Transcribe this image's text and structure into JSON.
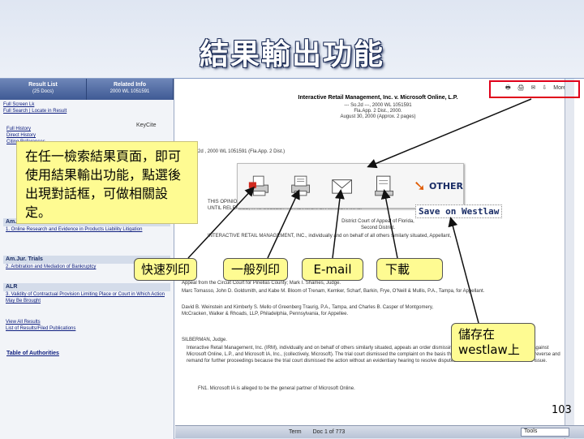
{
  "slide": {
    "title": "結果輸出功能",
    "page_number": "103",
    "note_text": "在任一檢索結果頁面，即可使用結果輸出功能，點選後出現對話框，可做相關設定。",
    "callouts": {
      "fast_print": "快速列印",
      "normal_print": "一般列印",
      "email": "E-mail",
      "download": "下載",
      "save_westlaw": "儲存在 westlaw上"
    }
  },
  "left_panel": {
    "tabs": [
      {
        "label": "Result List",
        "sub": "(25 Docs)"
      },
      {
        "label": "Related Info",
        "sub": "2000 WL 1051591"
      }
    ],
    "links": [
      "Full Screen Lk",
      "Full Search | Locate in Result"
    ],
    "keycite": "KeyCite",
    "keycite_links": [
      "Full History",
      "Direct History",
      "Citing References"
    ],
    "sections": [
      {
        "header": "Am.Jur. Proof of Facts",
        "items": [
          "1. Online Research and Evidence in Products Liability Litigation"
        ]
      },
      {
        "header": "Am.Jur. Trials",
        "items": [
          "2. Arbitration and Mediation of Bankruptcy"
        ]
      },
      {
        "header": "ALR",
        "items": [
          "3. Validity of Contractual Provision Limiting Place or Court in Which Action May Be Brought"
        ]
      }
    ],
    "more_links": [
      "View All Results",
      "List of Results/Filed Publications"
    ],
    "toa": "Table of Authorities"
  },
  "document": {
    "title": "Interactive Retail Management, Inc. v. Microsoft Online, L.P.",
    "meta": [
      "--- So.2d ---, 2000 WL 1051591",
      "Fla.App. 2 Dist., 2000.",
      "August 30, 2000 (Approx. 2 pages)"
    ],
    "cite": "2d , 2000 WL 1051591 (Fla.App. 2 Dist.)",
    "notice": "THIS OPINION HAS NOT BEEN RELEASED FOR PUBLICATION IN THE PERMANENT LAW REPORTS. UNTIL RELEASED, IT IS SUBJECT TO REVISION OR WITHDRAWAL.",
    "court": [
      "District Court of Appeal of Florida,",
      "Second District."
    ],
    "parties": "INTERACTIVE RETAIL MANAGEMENT, INC., individually and on behalf of all others similarly situated, Appellant,",
    "appeal": "Appeal from the Circuit Court for Pinellas County; Mark I. Shames, Judge.",
    "counsel1": "Marc Tomasso, John D. Goldsmith, and Kabe M. Bloom of Trenam, Kemker, Scharf, Barkin, Frye, O'Neill & Mullis, P.A., Tampa, for Appellant.",
    "counsel2": "David B. Weinstein and Kimberly S. Mello of Greenberg Traurig, P.A., Tampa, and Charles B. Casper of Montgomery, McCracken, Walker & Rhoads, LLP, Philadelphia, Pennsylvania, for Appellee.",
    "judge": "SILBERMAN, Judge.",
    "body": "Interactive Retail Management, Inc. (IRM), individually and on behalf of others similarly situated, appeals an order dismissing its amended class action complaint against Microsoft Online, L.P., and Microsoft IA, Inc., (collectively, Microsoft). The trial court dismissed the complaint on the basis that Florida was an improper venue. We reverse and remand for further proceedings because the trial court dismissed the action without an evidentiary hearing to resolve disputed issues of fact relevant to the venue issue.",
    "footnote": "FN1. Microsoft IA is alleged to be the general partner of Microsoft Online."
  },
  "toolbar": {
    "items": [
      "print-icon",
      "print-icon",
      "email-icon",
      "download-icon"
    ],
    "more": "More"
  },
  "delivery_dialog": {
    "other_label": "OTHER",
    "save_label": "Save on Westlaw"
  },
  "bottom_bar": {
    "term": "Term",
    "doc": "Doc 1 of 773",
    "tools": "Tools"
  }
}
